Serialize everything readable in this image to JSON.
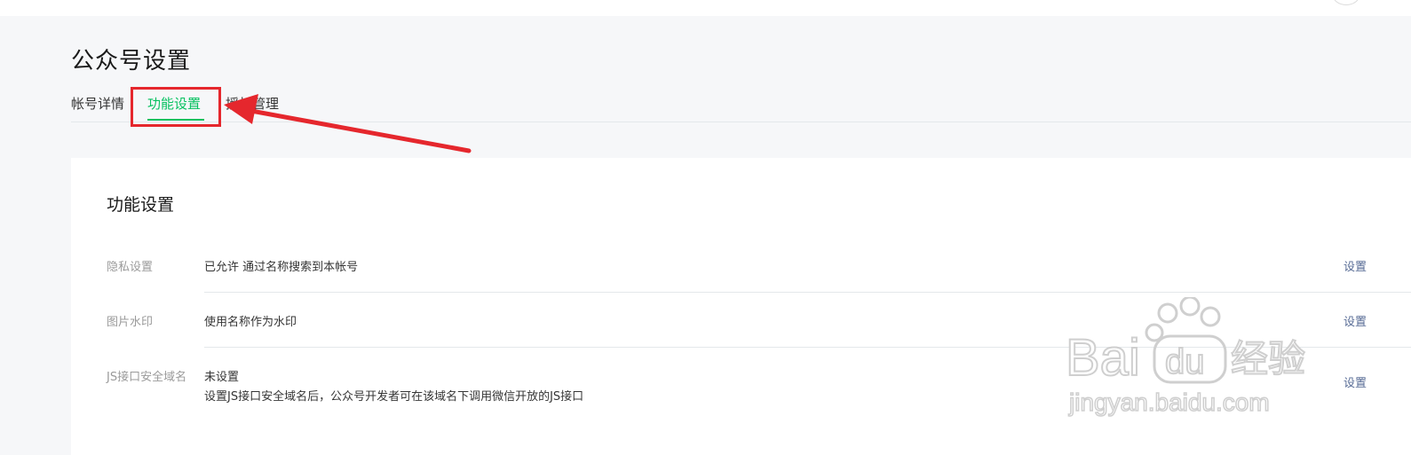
{
  "page": {
    "title": "公众号设置"
  },
  "tabs": [
    {
      "label": "帐号详情",
      "active": false
    },
    {
      "label": "功能设置",
      "active": true
    },
    {
      "label": "授权管理",
      "active": false
    }
  ],
  "card": {
    "title": "功能设置",
    "rows": [
      {
        "label": "隐私设置",
        "value": "已允许 通过名称搜索到本帐号",
        "action": "设置"
      },
      {
        "label": "图片水印",
        "value": "使用名称作为水印",
        "action": "设置"
      },
      {
        "label": "JS接口安全域名",
        "value": "未设置",
        "description": "设置JS接口安全域名后，公众号开发者可在该域名下调用微信开放的JS接口",
        "action": "设置"
      }
    ]
  },
  "watermark": {
    "brand": "Bai",
    "brand_paw": "du",
    "brand_suffix": "经验",
    "url": "jingyan.baidu.com"
  },
  "colors": {
    "accent": "#07c160",
    "link": "#576b95",
    "annotation": "#e5272d"
  }
}
